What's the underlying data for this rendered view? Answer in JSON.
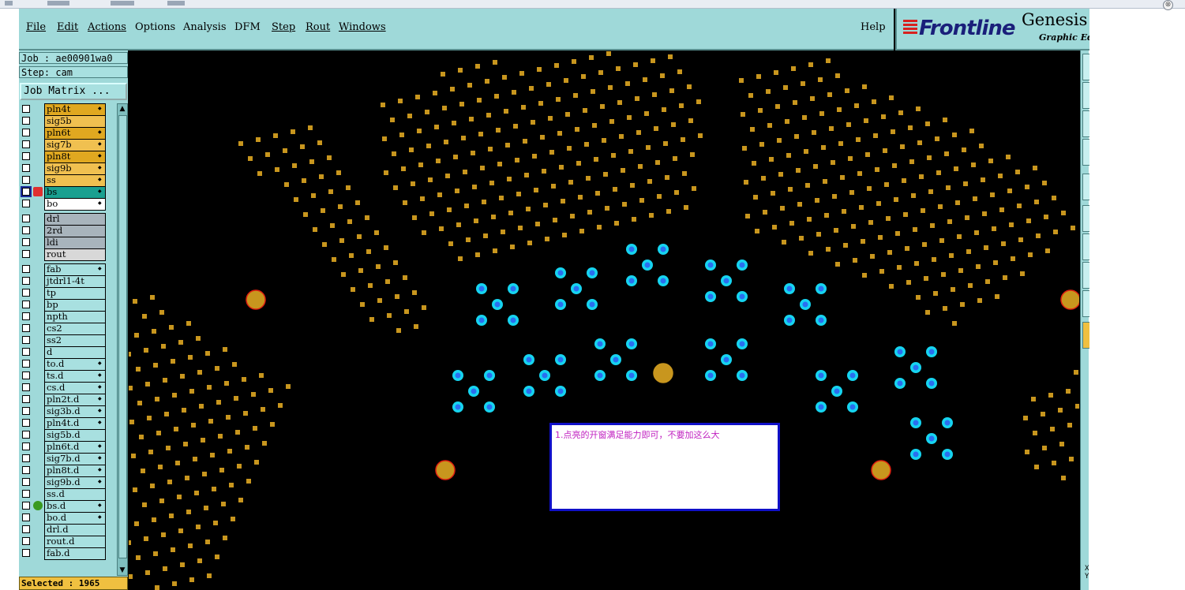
{
  "window": {
    "close_glyph": "⊗"
  },
  "menu": [
    {
      "label": "File",
      "underline": true
    },
    {
      "label": "Edit",
      "underline": true
    },
    {
      "label": "Actions",
      "underline": true
    },
    {
      "label": "Options",
      "underline": false
    },
    {
      "label": "Analysis",
      "underline": false
    },
    {
      "label": "DFM",
      "underline": false
    },
    {
      "label": "Step",
      "underline": true
    },
    {
      "label": "Rout",
      "underline": true
    },
    {
      "label": "Windows",
      "underline": true
    }
  ],
  "help_label": "Help",
  "brand": {
    "name": "Frontline",
    "product": "Genesis",
    "subtitle": "Graphic Ed"
  },
  "panel": {
    "job": "Job : ae00901wa0",
    "step": "Step: cam",
    "job_matrix": "Job Matrix ...",
    "selected": "Selected : 1965",
    "scroll_up": "▲",
    "scroll_down": "▼"
  },
  "layers": [
    {
      "name": "pln4t",
      "color": "#e0a820",
      "arrow": true
    },
    {
      "name": "sig5b",
      "color": "#f0c050",
      "arrow": false
    },
    {
      "name": "pln6t",
      "color": "#e0a820",
      "arrow": true
    },
    {
      "name": "sig7b",
      "color": "#f0c050",
      "arrow": true
    },
    {
      "name": "pln8t",
      "color": "#e0a820",
      "arrow": true
    },
    {
      "name": "sig9b",
      "color": "#f0c050",
      "arrow": true
    },
    {
      "name": "ss",
      "color": "#f0c050",
      "arrow": true
    },
    {
      "name": "bs",
      "color": "#1aa090",
      "arrow": true,
      "active": true
    },
    {
      "name": "bo",
      "color": "#ffffff",
      "arrow": true
    },
    {
      "name": "drl",
      "color": "#a8b4bc",
      "arrow": false,
      "gap": true
    },
    {
      "name": "2rd",
      "color": "#a8b4bc",
      "arrow": false
    },
    {
      "name": "ldi",
      "color": "#a8b4bc",
      "arrow": false
    },
    {
      "name": "rout",
      "color": "#d8d8d8",
      "arrow": false
    },
    {
      "name": "fab",
      "color": "#a8e0e0",
      "arrow": true,
      "gap": true
    },
    {
      "name": "jtdrl1-4t",
      "color": "#a8e0e0",
      "arrow": false
    },
    {
      "name": "tp",
      "color": "#a8e0e0",
      "arrow": false
    },
    {
      "name": "bp",
      "color": "#a8e0e0",
      "arrow": false
    },
    {
      "name": "npth",
      "color": "#a8e0e0",
      "arrow": false
    },
    {
      "name": "cs2",
      "color": "#a8e0e0",
      "arrow": false
    },
    {
      "name": "ss2",
      "color": "#a8e0e0",
      "arrow": false
    },
    {
      "name": "d",
      "color": "#a8e0e0",
      "arrow": false
    },
    {
      "name": "to.d",
      "color": "#a8e0e0",
      "arrow": true
    },
    {
      "name": "ts.d",
      "color": "#a8e0e0",
      "arrow": true
    },
    {
      "name": "cs.d",
      "color": "#a8e0e0",
      "arrow": true
    },
    {
      "name": "pln2t.d",
      "color": "#a8e0e0",
      "arrow": true
    },
    {
      "name": "sig3b.d",
      "color": "#a8e0e0",
      "arrow": true
    },
    {
      "name": "pln4t.d",
      "color": "#a8e0e0",
      "arrow": true
    },
    {
      "name": "sig5b.d",
      "color": "#a8e0e0",
      "arrow": false
    },
    {
      "name": "pln6t.d",
      "color": "#a8e0e0",
      "arrow": true
    },
    {
      "name": "sig7b.d",
      "color": "#a8e0e0",
      "arrow": true
    },
    {
      "name": "pln8t.d",
      "color": "#a8e0e0",
      "arrow": true
    },
    {
      "name": "sig9b.d",
      "color": "#a8e0e0",
      "arrow": true
    },
    {
      "name": "ss.d",
      "color": "#a8e0e0",
      "arrow": false
    },
    {
      "name": "bs.d",
      "color": "#a8e0e0",
      "arrow": true,
      "dot": true
    },
    {
      "name": "bo.d",
      "color": "#a8e0e0",
      "arrow": true
    },
    {
      "name": "drl.d",
      "color": "#a8e0e0",
      "arrow": false
    },
    {
      "name": "rout.d",
      "color": "#a8e0e0",
      "arrow": false
    },
    {
      "name": "fab.d",
      "color": "#a8e0e0",
      "arrow": false
    }
  ],
  "note": {
    "text": "1.点亮的开窗满足能力即可，不要加这么大"
  },
  "right_strip": {
    "coords": "X\nY"
  },
  "colors": {
    "pad": "#c8961e",
    "highlight": "#16d4f0",
    "highlight_center": "#2a6ef0",
    "fiducial": "#c8961e",
    "fiducial_ring": "#e02010"
  }
}
